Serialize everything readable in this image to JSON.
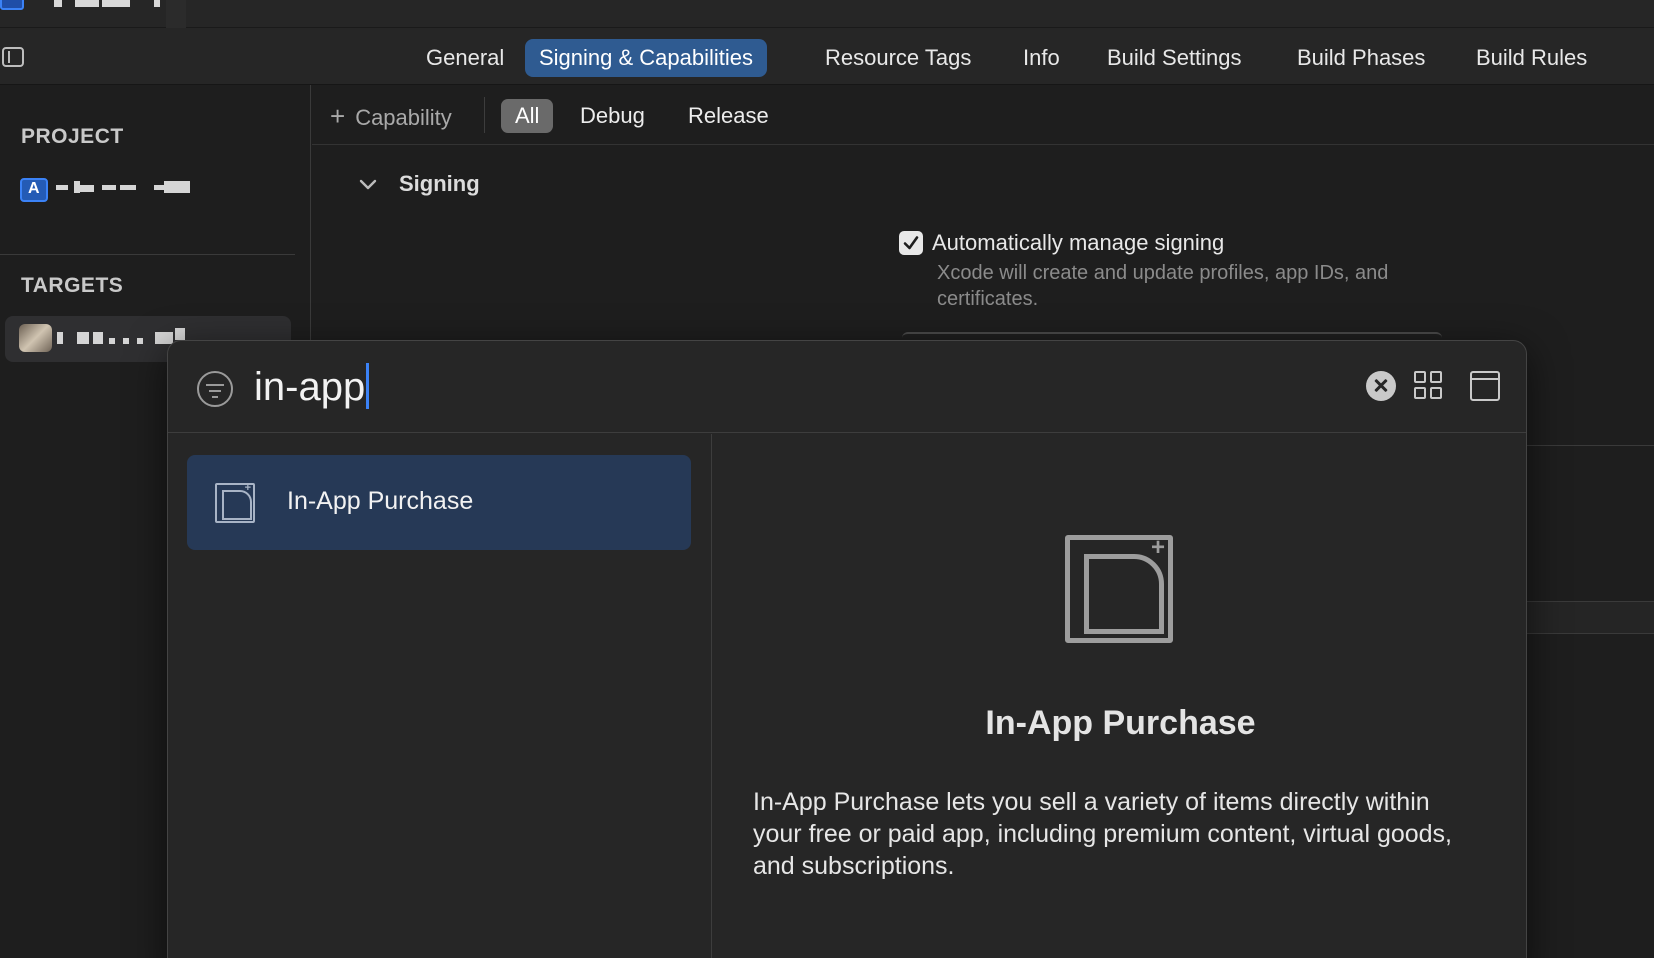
{
  "tabs": [
    {
      "label": "General"
    },
    {
      "label": "Signing & Capabilities",
      "active": true
    },
    {
      "label": "Resource Tags"
    },
    {
      "label": "Info"
    },
    {
      "label": "Build Settings"
    },
    {
      "label": "Build Phases"
    },
    {
      "label": "Build Rules"
    }
  ],
  "sidebar": {
    "project_label": "PROJECT",
    "targets_label": "TARGETS"
  },
  "capability_bar": {
    "add_label": "Capability",
    "segments": [
      {
        "label": "All",
        "active": true
      },
      {
        "label": "Debug"
      },
      {
        "label": "Release"
      }
    ]
  },
  "signing": {
    "title": "Signing",
    "auto_manage_label": "Automatically manage signing",
    "auto_manage_checked": true,
    "auto_manage_description": "Xcode will create and update profiles, app IDs, and certificates."
  },
  "library": {
    "search_value": "in-app",
    "results": [
      {
        "label": "In-App Purchase",
        "icon": "in-app-purchase-icon",
        "selected": true
      }
    ],
    "detail": {
      "title": "In-App Purchase",
      "description": "In-App Purchase lets you sell a variety of items directly within your free or paid app, including premium content, virtual goods, and subscriptions."
    }
  },
  "colors": {
    "accent": "#3b82f6",
    "active_tab": "#2f5b91",
    "selected_row": "#263956"
  }
}
